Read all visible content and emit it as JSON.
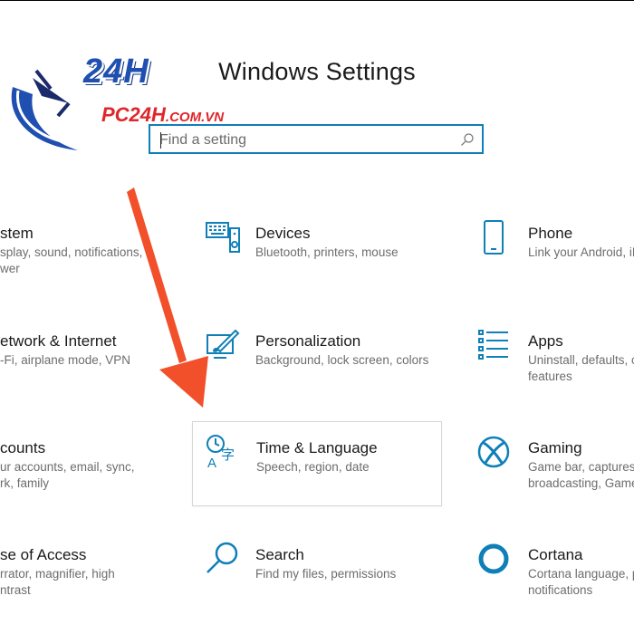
{
  "window": {
    "title": "Windows Settings"
  },
  "watermark": {
    "brand": "24H",
    "site": "PC24H",
    "domain": ".COM.VN"
  },
  "search": {
    "placeholder": "Find a setting",
    "value": ""
  },
  "colors": {
    "accent": "#0f7fb8",
    "arrow": "#f2502a",
    "text": "#1a1a1a",
    "secondary": "#6d6d6d"
  },
  "tiles": [
    {
      "label": "stem",
      "desc_lines": [
        "splay, sound, notifications,",
        "wer"
      ],
      "icon": "system-icon"
    },
    {
      "label": "Devices",
      "desc_lines": [
        "Bluetooth, printers, mouse"
      ],
      "icon": "keyboard-speaker-icon"
    },
    {
      "label": "Phone",
      "desc_lines": [
        "Link your Android, iPh"
      ],
      "icon": "phone-icon"
    },
    {
      "label": "etwork & Internet",
      "desc_lines": [
        "-Fi, airplane mode, VPN"
      ],
      "icon": "globe-icon"
    },
    {
      "label": "Personalization",
      "desc_lines": [
        "Background, lock screen, colors"
      ],
      "icon": "paintbrush-monitor-icon"
    },
    {
      "label": "Apps",
      "desc_lines": [
        "Uninstall, defaults, op",
        "features"
      ],
      "icon": "apps-list-icon"
    },
    {
      "label": "counts",
      "desc_lines": [
        "ur accounts, email, sync,",
        "rk, family"
      ],
      "icon": "person-icon"
    },
    {
      "label": "Time & Language",
      "desc_lines": [
        "Speech, region, date"
      ],
      "icon": "time-language-icon"
    },
    {
      "label": "Gaming",
      "desc_lines": [
        "Game bar, captures, br",
        "broadcasting, Game M"
      ],
      "icon": "xbox-icon"
    },
    {
      "label": "se of Access",
      "desc_lines": [
        "rrator, magnifier, high",
        "ntrast"
      ],
      "icon": "ease-of-access-icon"
    },
    {
      "label": "Search",
      "desc_lines": [
        "Find my files, permissions"
      ],
      "icon": "search-icon"
    },
    {
      "label": "Cortana",
      "desc_lines": [
        "Cortana language, perm",
        "notifications"
      ],
      "icon": "cortana-icon"
    }
  ]
}
